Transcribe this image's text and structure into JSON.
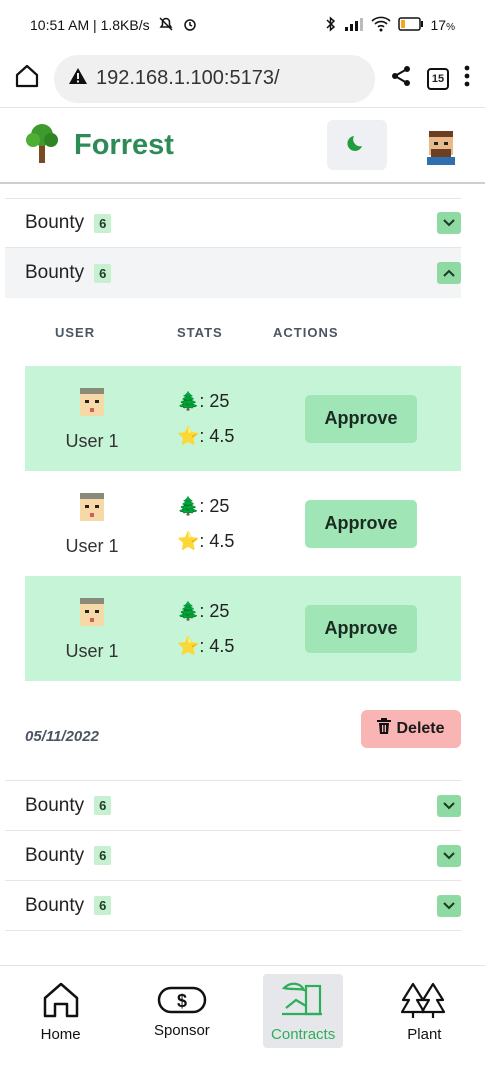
{
  "status_bar": {
    "time_speed": "10:51 AM | 1.8KB/s",
    "battery": "17"
  },
  "browser": {
    "url": "192.168.1.100:5173/",
    "tab_count": "15"
  },
  "header": {
    "title": "Forrest"
  },
  "bounties_top": [
    {
      "label": "Bounty",
      "count": "6"
    },
    {
      "label": "Bounty",
      "count": "6"
    }
  ],
  "table": {
    "col_user": "USER",
    "col_stats": "STATS",
    "col_actions": "ACTIONS",
    "rows": [
      {
        "user": "User 1",
        "trees": ": 25",
        "rating": ": 4.5",
        "action": "Approve"
      },
      {
        "user": "User 1",
        "trees": ": 25",
        "rating": ": 4.5",
        "action": "Approve"
      },
      {
        "user": "User 1",
        "trees": ": 25",
        "rating": ": 4.5",
        "action": "Approve"
      }
    ],
    "date": "05/11/2022",
    "delete_label": "Delete"
  },
  "bounties_bottom": [
    {
      "label": "Bounty",
      "count": "6"
    },
    {
      "label": "Bounty",
      "count": "6"
    },
    {
      "label": "Bounty",
      "count": "6"
    }
  ],
  "nav": {
    "home": "Home",
    "sponsor": "Sponsor",
    "contracts": "Contracts",
    "plant": "Plant"
  },
  "colors": {
    "brand_green": "#2e8b57",
    "row_green": "#c6f4d6",
    "approve_green": "#9fe5b6",
    "delete_red": "#f9b4b4",
    "active_nav": "#2fae5a"
  }
}
